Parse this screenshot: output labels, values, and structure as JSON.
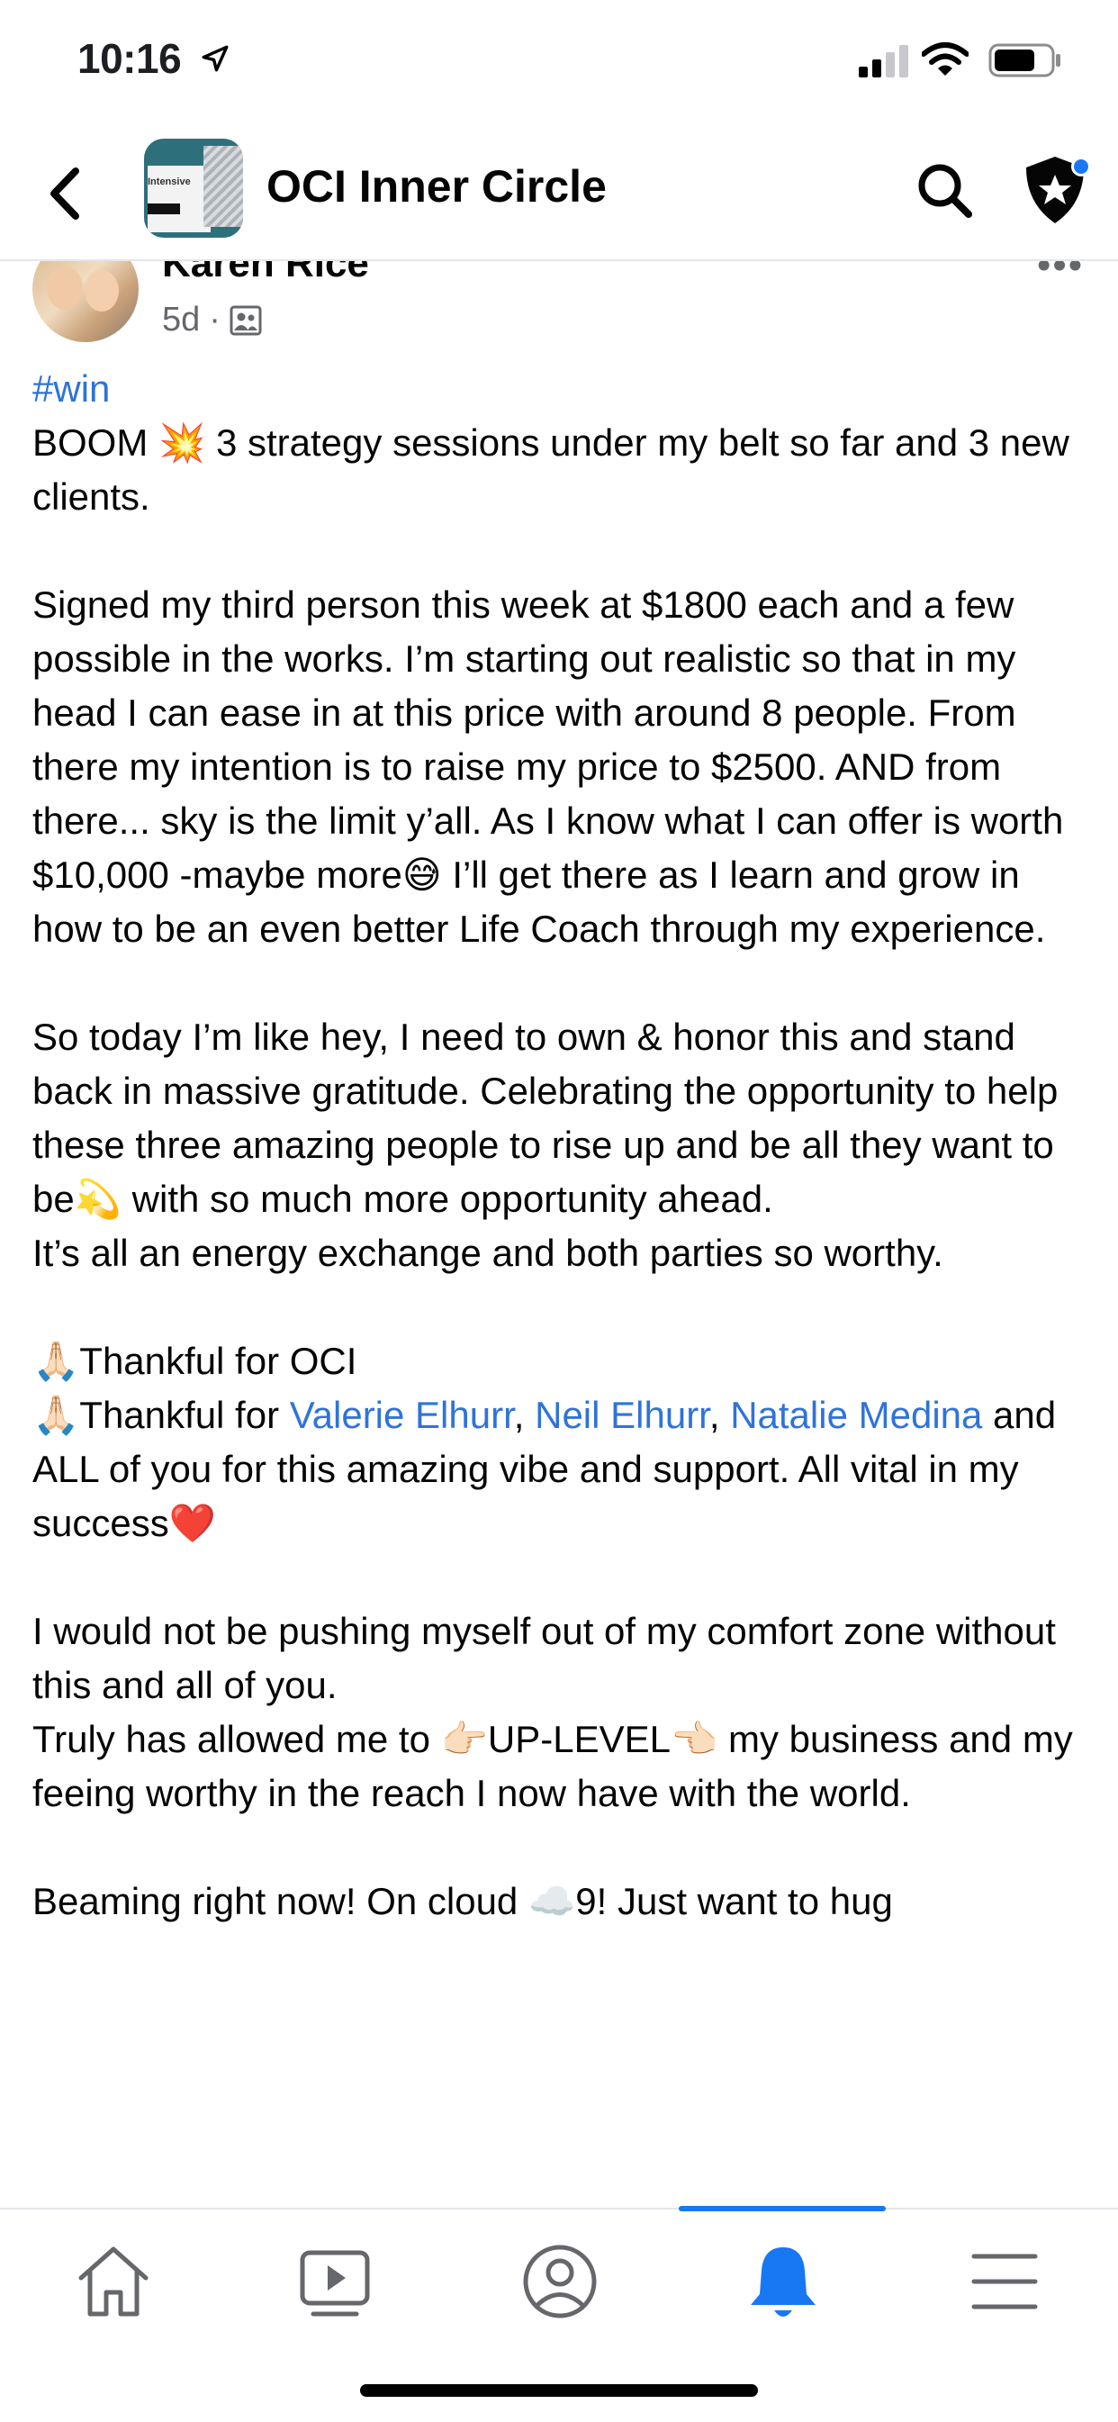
{
  "status_bar": {
    "time": "10:16"
  },
  "header": {
    "group_name": "OCI Inner Circle",
    "group_avatar_text": "Intensive"
  },
  "post": {
    "author": "Karen Rice",
    "age": "5d",
    "hashtag": "#win",
    "paragraph1": "BOOM 💥 3 strategy sessions under my belt so far and 3 new clients.",
    "paragraph2": "Signed my third person this week at $1800 each and a few possible in the works.  I’m starting out realistic so that in my head I can ease in at this price with around 8 people.  From there my intention is to raise my price to $2500.  AND from there... sky is the limit y’all.  As I know what I can offer is worth $10,000 -maybe more😅 I’ll get there as I learn and grow in how to be an even better Life Coach through my experience.",
    "paragraph3": "So today I’m like hey, I need to own & honor this and stand back in massive gratitude.  Celebrating the opportunity to help these three amazing people to rise up and be all they want to be💫 with so much more opportunity ahead.",
    "paragraph3b": "It’s all an energy exchange and both parties so worthy.",
    "thanks1": "🙏🏻Thankful for OCI",
    "thanks2_prefix": "🙏🏻Thankful for ",
    "mentions": [
      "Valerie Elhurr",
      "Neil Elhurr",
      "Natalie Medina"
    ],
    "mention_sep": ", ",
    "thanks2_suffix": " and ALL of you for this amazing vibe and support.  All vital in my success❤️",
    "paragraph5a": "I would not be pushing myself out of my comfort zone without this and all of you.",
    "paragraph5b": "Truly has allowed me to 👉🏻UP-LEVEL👈🏻 my business and my feeing worthy in the reach I now have with the world.",
    "paragraph6": "Beaming right now!  On cloud ☁️9! Just want to hug"
  },
  "bottom_nav": {
    "items": [
      "home-icon",
      "video-icon",
      "profile-icon",
      "notifications-icon",
      "menu-icon"
    ],
    "active": "notifications-icon",
    "active_color": "#1877f2"
  },
  "colors": {
    "link": "#2f73d9",
    "accent": "#1877f2"
  }
}
